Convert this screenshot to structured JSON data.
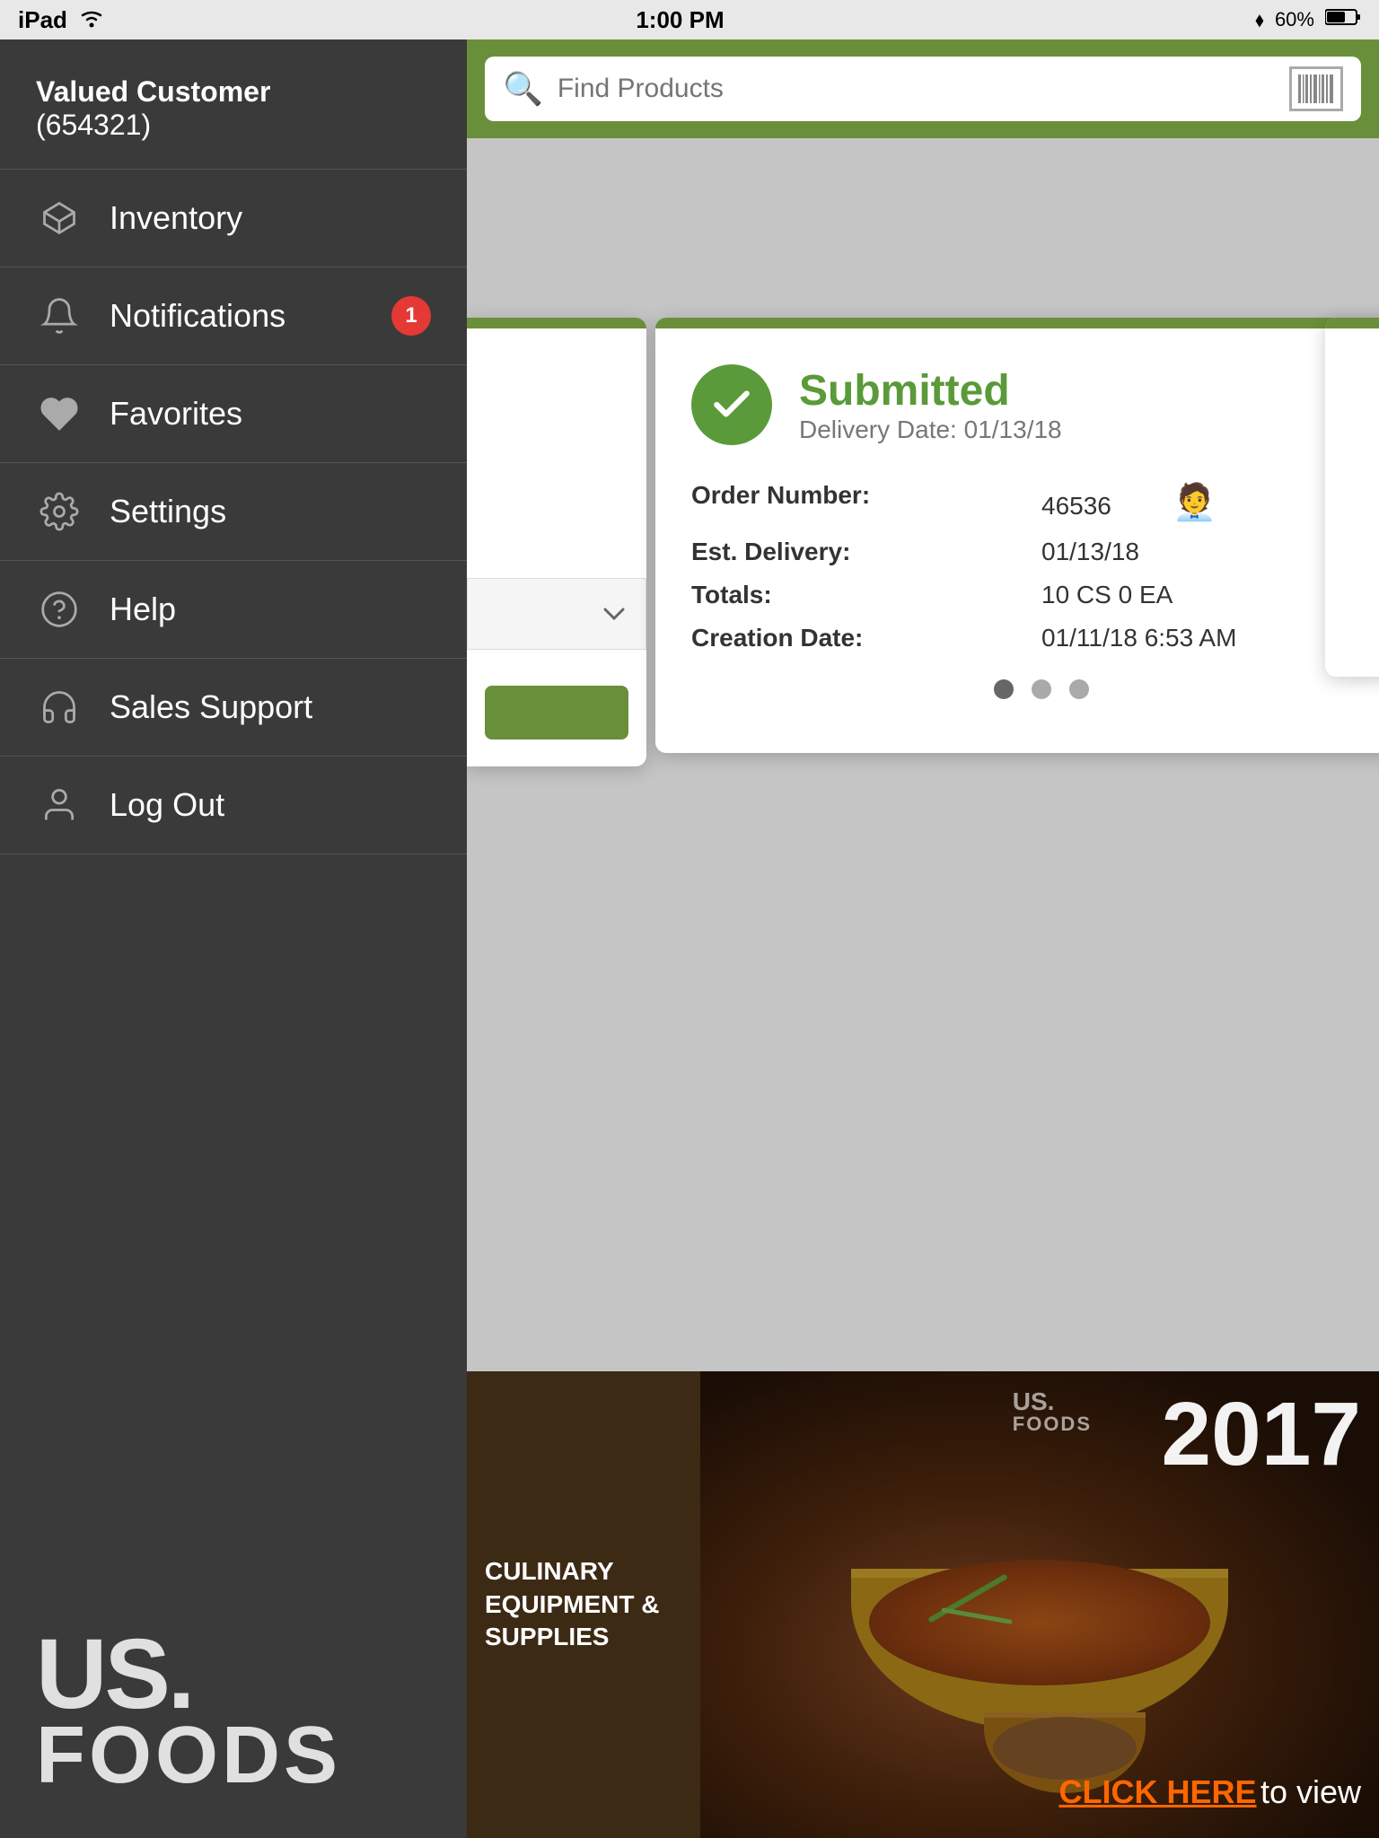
{
  "statusBar": {
    "device": "iPad",
    "wifi": "wifi",
    "time": "1:00 PM",
    "bluetooth": "60%"
  },
  "sidebar": {
    "user": {
      "name": "Valued Customer",
      "id": "(654321)"
    },
    "items": [
      {
        "id": "inventory",
        "label": "Inventory",
        "icon": "box-icon",
        "badge": null
      },
      {
        "id": "notifications",
        "label": "Notifications",
        "icon": "bell-icon",
        "badge": "1"
      },
      {
        "id": "favorites",
        "label": "Favorites",
        "icon": "heart-icon",
        "badge": null
      },
      {
        "id": "settings",
        "label": "Settings",
        "icon": "gear-icon",
        "badge": null
      },
      {
        "id": "help",
        "label": "Help",
        "icon": "question-icon",
        "badge": null
      },
      {
        "id": "sales-support",
        "label": "Sales Support",
        "icon": "headset-icon",
        "badge": null
      },
      {
        "id": "logout",
        "label": "Log Out",
        "icon": "person-icon",
        "badge": null
      }
    ],
    "logo": {
      "us": "US.",
      "foods": "FOODS"
    }
  },
  "header": {
    "search": {
      "placeholder": "Find Products"
    }
  },
  "orderCard": {
    "status": "Submitted",
    "deliveryDateLabel": "Delivery Date:",
    "deliveryDate": "01/13/18",
    "fields": [
      {
        "label": "Order Number:",
        "value": "46536"
      },
      {
        "label": "Est. Delivery:",
        "value": "01/13/18"
      },
      {
        "label": "Totals:",
        "value": "10 CS  0 EA"
      },
      {
        "label": "Creation Date:",
        "value": "01/11/18 6:53 AM"
      }
    ],
    "dots": [
      {
        "active": true
      },
      {
        "active": false
      },
      {
        "active": false
      }
    ]
  },
  "promo": {
    "text": "CULINARY EQUIPMENT & SUPPLIES",
    "year": "2017",
    "cta": "CLICK HERE",
    "ctaSuffix": " to view"
  }
}
